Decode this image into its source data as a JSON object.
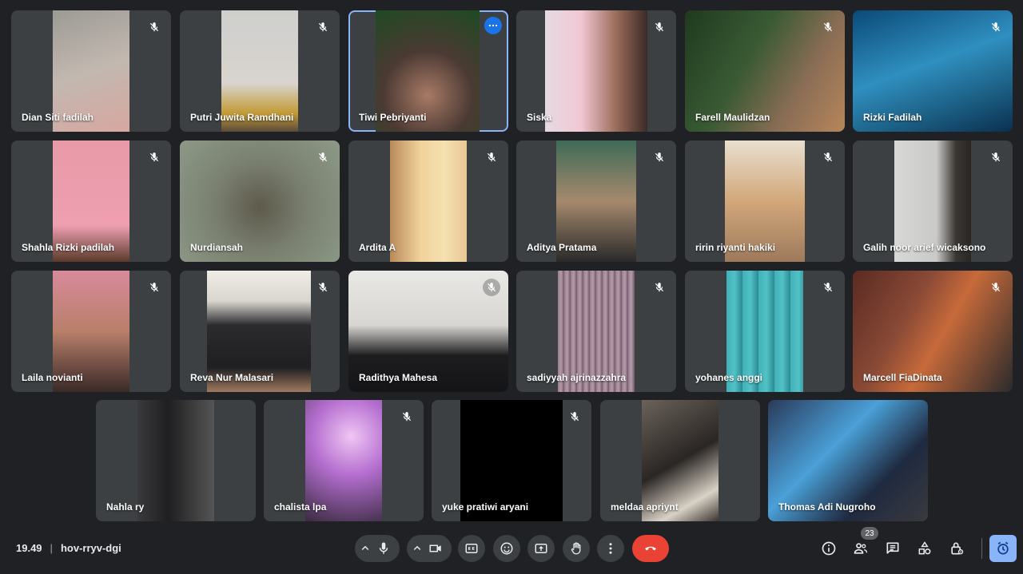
{
  "meeting": {
    "time": "19.49",
    "code": "hov-rryv-dgi"
  },
  "participants_count": "23",
  "colors": {
    "background": "#202124",
    "tile": "#3c4043",
    "active_outline": "#8ab4f8",
    "hangup": "#ea4335",
    "accent": "#1a73e8"
  },
  "tiles": [
    {
      "name": "Dian Siti fadilah"
    },
    {
      "name": "Putri Juwita Ramdhani"
    },
    {
      "name": "Tiwi Pebriyanti"
    },
    {
      "name": "Siska"
    },
    {
      "name": "Farell Maulidzan"
    },
    {
      "name": "Rizki Fadilah"
    },
    {
      "name": "Shahla Rizki padilah"
    },
    {
      "name": "Nurdiansah"
    },
    {
      "name": "Ardita A"
    },
    {
      "name": "Aditya Pratama"
    },
    {
      "name": "ririn riyanti hakiki"
    },
    {
      "name": "Galih noor arief wicaksono"
    },
    {
      "name": "Laila novianti"
    },
    {
      "name": "Reva Nur Malasari"
    },
    {
      "name": "Radithya Mahesa"
    },
    {
      "name": "sadiyyah ajrinazzahra"
    },
    {
      "name": "yohanes anggi"
    },
    {
      "name": "Marcell FiaDinata"
    },
    {
      "name": "Nahla ry"
    },
    {
      "name": "chalista lpa"
    },
    {
      "name": "yuke pratiwi aryani"
    },
    {
      "name": "meldaa apriynt"
    },
    {
      "name": "Thomas Adi Nugroho"
    }
  ],
  "icons": {
    "mic": "microphone-icon",
    "camera": "video-camera-icon",
    "captions": "closed-captions-icon",
    "emoji": "emoji-icon",
    "present": "present-screen-icon",
    "hand": "raise-hand-icon",
    "more": "more-vert-icon",
    "hangup": "call-end-icon",
    "info": "info-icon",
    "people": "people-icon",
    "chat": "chat-icon",
    "activities": "activities-icon",
    "host": "host-controls-icon",
    "timer": "timer-icon"
  }
}
